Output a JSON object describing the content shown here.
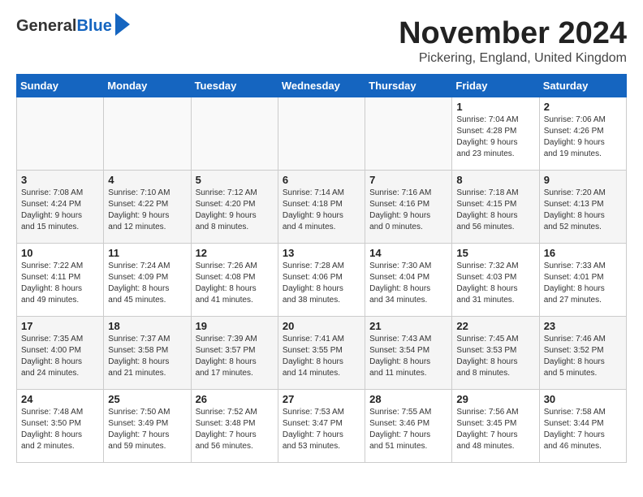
{
  "header": {
    "logo_line1": "General",
    "logo_line2": "Blue",
    "month": "November 2024",
    "location": "Pickering, England, United Kingdom"
  },
  "days_of_week": [
    "Sunday",
    "Monday",
    "Tuesday",
    "Wednesday",
    "Thursday",
    "Friday",
    "Saturday"
  ],
  "weeks": [
    [
      {
        "day": "",
        "info": ""
      },
      {
        "day": "",
        "info": ""
      },
      {
        "day": "",
        "info": ""
      },
      {
        "day": "",
        "info": ""
      },
      {
        "day": "",
        "info": ""
      },
      {
        "day": "1",
        "info": "Sunrise: 7:04 AM\nSunset: 4:28 PM\nDaylight: 9 hours\nand 23 minutes."
      },
      {
        "day": "2",
        "info": "Sunrise: 7:06 AM\nSunset: 4:26 PM\nDaylight: 9 hours\nand 19 minutes."
      }
    ],
    [
      {
        "day": "3",
        "info": "Sunrise: 7:08 AM\nSunset: 4:24 PM\nDaylight: 9 hours\nand 15 minutes."
      },
      {
        "day": "4",
        "info": "Sunrise: 7:10 AM\nSunset: 4:22 PM\nDaylight: 9 hours\nand 12 minutes."
      },
      {
        "day": "5",
        "info": "Sunrise: 7:12 AM\nSunset: 4:20 PM\nDaylight: 9 hours\nand 8 minutes."
      },
      {
        "day": "6",
        "info": "Sunrise: 7:14 AM\nSunset: 4:18 PM\nDaylight: 9 hours\nand 4 minutes."
      },
      {
        "day": "7",
        "info": "Sunrise: 7:16 AM\nSunset: 4:16 PM\nDaylight: 9 hours\nand 0 minutes."
      },
      {
        "day": "8",
        "info": "Sunrise: 7:18 AM\nSunset: 4:15 PM\nDaylight: 8 hours\nand 56 minutes."
      },
      {
        "day": "9",
        "info": "Sunrise: 7:20 AM\nSunset: 4:13 PM\nDaylight: 8 hours\nand 52 minutes."
      }
    ],
    [
      {
        "day": "10",
        "info": "Sunrise: 7:22 AM\nSunset: 4:11 PM\nDaylight: 8 hours\nand 49 minutes."
      },
      {
        "day": "11",
        "info": "Sunrise: 7:24 AM\nSunset: 4:09 PM\nDaylight: 8 hours\nand 45 minutes."
      },
      {
        "day": "12",
        "info": "Sunrise: 7:26 AM\nSunset: 4:08 PM\nDaylight: 8 hours\nand 41 minutes."
      },
      {
        "day": "13",
        "info": "Sunrise: 7:28 AM\nSunset: 4:06 PM\nDaylight: 8 hours\nand 38 minutes."
      },
      {
        "day": "14",
        "info": "Sunrise: 7:30 AM\nSunset: 4:04 PM\nDaylight: 8 hours\nand 34 minutes."
      },
      {
        "day": "15",
        "info": "Sunrise: 7:32 AM\nSunset: 4:03 PM\nDaylight: 8 hours\nand 31 minutes."
      },
      {
        "day": "16",
        "info": "Sunrise: 7:33 AM\nSunset: 4:01 PM\nDaylight: 8 hours\nand 27 minutes."
      }
    ],
    [
      {
        "day": "17",
        "info": "Sunrise: 7:35 AM\nSunset: 4:00 PM\nDaylight: 8 hours\nand 24 minutes."
      },
      {
        "day": "18",
        "info": "Sunrise: 7:37 AM\nSunset: 3:58 PM\nDaylight: 8 hours\nand 21 minutes."
      },
      {
        "day": "19",
        "info": "Sunrise: 7:39 AM\nSunset: 3:57 PM\nDaylight: 8 hours\nand 17 minutes."
      },
      {
        "day": "20",
        "info": "Sunrise: 7:41 AM\nSunset: 3:55 PM\nDaylight: 8 hours\nand 14 minutes."
      },
      {
        "day": "21",
        "info": "Sunrise: 7:43 AM\nSunset: 3:54 PM\nDaylight: 8 hours\nand 11 minutes."
      },
      {
        "day": "22",
        "info": "Sunrise: 7:45 AM\nSunset: 3:53 PM\nDaylight: 8 hours\nand 8 minutes."
      },
      {
        "day": "23",
        "info": "Sunrise: 7:46 AM\nSunset: 3:52 PM\nDaylight: 8 hours\nand 5 minutes."
      }
    ],
    [
      {
        "day": "24",
        "info": "Sunrise: 7:48 AM\nSunset: 3:50 PM\nDaylight: 8 hours\nand 2 minutes."
      },
      {
        "day": "25",
        "info": "Sunrise: 7:50 AM\nSunset: 3:49 PM\nDaylight: 7 hours\nand 59 minutes."
      },
      {
        "day": "26",
        "info": "Sunrise: 7:52 AM\nSunset: 3:48 PM\nDaylight: 7 hours\nand 56 minutes."
      },
      {
        "day": "27",
        "info": "Sunrise: 7:53 AM\nSunset: 3:47 PM\nDaylight: 7 hours\nand 53 minutes."
      },
      {
        "day": "28",
        "info": "Sunrise: 7:55 AM\nSunset: 3:46 PM\nDaylight: 7 hours\nand 51 minutes."
      },
      {
        "day": "29",
        "info": "Sunrise: 7:56 AM\nSunset: 3:45 PM\nDaylight: 7 hours\nand 48 minutes."
      },
      {
        "day": "30",
        "info": "Sunrise: 7:58 AM\nSunset: 3:44 PM\nDaylight: 7 hours\nand 46 minutes."
      }
    ]
  ]
}
